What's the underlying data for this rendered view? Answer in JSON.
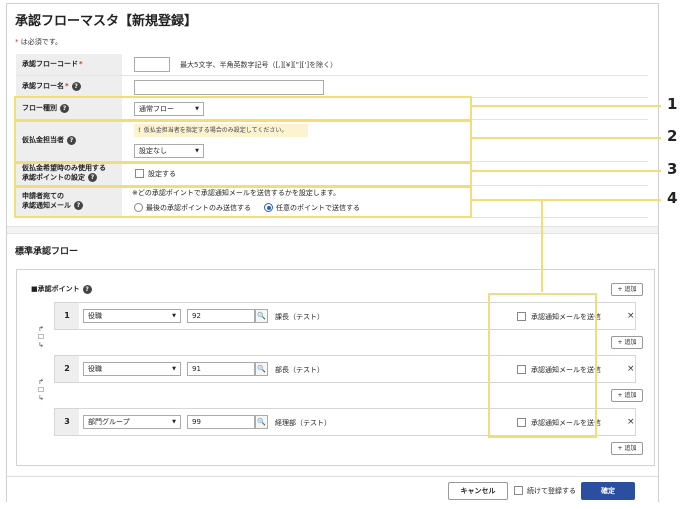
{
  "page": {
    "title": "承認フローマスタ【新規登録】",
    "required_mark": "*",
    "required_note": "は必須です。"
  },
  "form": {
    "code": {
      "label": "承認フローコード",
      "required": "*",
      "hint": "最大5文字、半角英数字記号（[,][¥][\"][']を除く）"
    },
    "name": {
      "label": "承認フロー名",
      "required": "*"
    },
    "flow_type": {
      "label": "フロー種別",
      "value": "通常フロー"
    },
    "advance_person": {
      "label": "仮払金担当者",
      "warning": "仮払金担当者を指定する場合のみ設定してください。",
      "value": "設定なし"
    },
    "advance_point": {
      "label_line1": "仮払金希望時のみ使用する",
      "label_line2": "承認ポイントの設定",
      "checkbox_label": "設定する"
    },
    "notify": {
      "label_line1": "申請者宛ての",
      "label_line2": "承認通知メール",
      "note": "※どの承認ポイントで承認通知メールを送信するかを設定します。",
      "option1": "最後の承認ポイントのみ送信する",
      "option2": "任意のポイントで送信する",
      "selected": "option2"
    }
  },
  "callouts": [
    "1",
    "2",
    "3",
    "4"
  ],
  "standard_flow": {
    "title": "標準承認フロー",
    "points_label": "■承認ポイント",
    "add_label": "+ 追加",
    "notify_label": "承認通知メールを送信",
    "remove_label": "×",
    "points": [
      {
        "num": "1",
        "type": "役職",
        "code": "92",
        "name": "課長（テスト）"
      },
      {
        "num": "2",
        "type": "役職",
        "code": "91",
        "name": "部長（テスト）"
      },
      {
        "num": "3",
        "type": "部門グループ",
        "code": "99",
        "name": "経理部（テスト）"
      }
    ]
  },
  "footer": {
    "cancel": "キャンセル",
    "continue_label": "続けて登録する",
    "confirm": "確定"
  },
  "colors": {
    "highlight": "#f2dd7c",
    "primary": "#2a4f9e",
    "required": "#c0392b"
  }
}
